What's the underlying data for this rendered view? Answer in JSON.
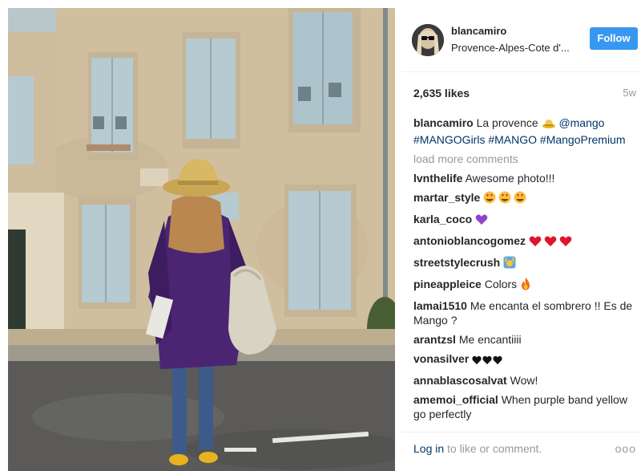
{
  "post": {
    "username": "blancamiro",
    "location": "Provence-Alpes-Cote d'...",
    "follow_label": "Follow",
    "likes": "2,635 likes",
    "age": "5w"
  },
  "caption": {
    "user": "blancamiro",
    "text": "La provence",
    "emoji": "hat-emoji",
    "mention": "@mango",
    "hashtags": "#MANGOGirls #MANGO #MangoPremium"
  },
  "load_more": "load more comments",
  "comments": [
    {
      "user": "lvnthelife",
      "text": "Awesome photo!!!"
    },
    {
      "user": "martar_style",
      "text": "",
      "emoji": "heart-eyes-emoji x3"
    },
    {
      "user": "karla_coco",
      "text": "",
      "emoji": "purple-heart-emoji"
    },
    {
      "user": "antonioblancogomez",
      "text": "",
      "emoji": "red-heart-emoji x3"
    },
    {
      "user": "streetstylecrush",
      "text": "",
      "emoji": "raised-hands-emoji"
    },
    {
      "user": "pineappleice",
      "text": "Colors",
      "emoji": "fire-emoji"
    },
    {
      "user": "lamai1510",
      "text": "Me encanta el sombrero !! Es de Mango ?"
    },
    {
      "user": "arantzsl",
      "text": "Me encantiiii"
    },
    {
      "user": "vonasilver",
      "text": "",
      "emoji": "black-heart-emoji x3"
    },
    {
      "user": "annablascosalvat",
      "text": "Wow!"
    },
    {
      "user": "amemoi_official",
      "text": "When purple band yellow go perfectly"
    }
  ],
  "footer": {
    "login_link": "Log in",
    "login_text": "to like or comment.",
    "more_label": "ooo"
  },
  "colors": {
    "accent": "#3897f0",
    "link": "#003569",
    "muted": "#999999",
    "text": "#262626"
  }
}
